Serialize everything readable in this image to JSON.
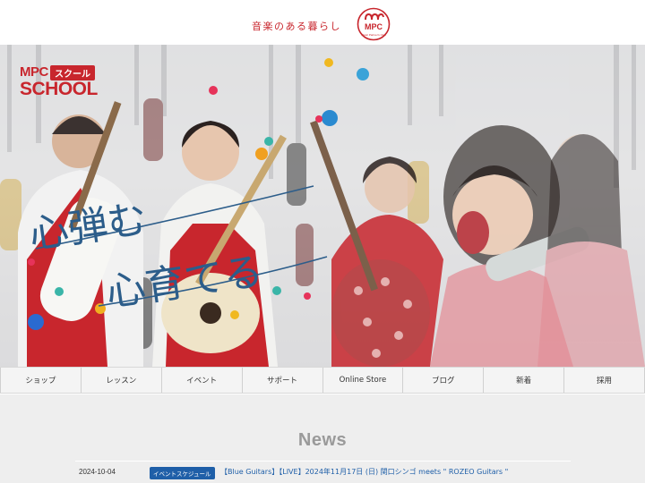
{
  "header": {
    "tagline": "音楽のある暮らし",
    "logo_text": "MPC",
    "logo_subtext": "Music Partner's Club"
  },
  "hero": {
    "logo_mpc": "MPC",
    "logo_badge": "スクール",
    "logo_school": "SCHOOL",
    "headline_line1": "心弾む",
    "headline_line2": "心育てる"
  },
  "nav": {
    "items": [
      "ショップ",
      "レッスン",
      "イベント",
      "サポート",
      "Online Store",
      "ブログ",
      "新着",
      "採用"
    ]
  },
  "news": {
    "title": "News",
    "items": [
      {
        "date": "2024-10-04",
        "category": "イベントスケジュール",
        "text": "【Blue Guitars】【LIVE】2024年11月17日 (日) 関口シンゴ meets \" ROZEO Guitars \""
      }
    ]
  },
  "colors": {
    "brand_red": "#c8262d",
    "link_blue": "#1f5fa8",
    "news_bg": "#eeeeee"
  }
}
